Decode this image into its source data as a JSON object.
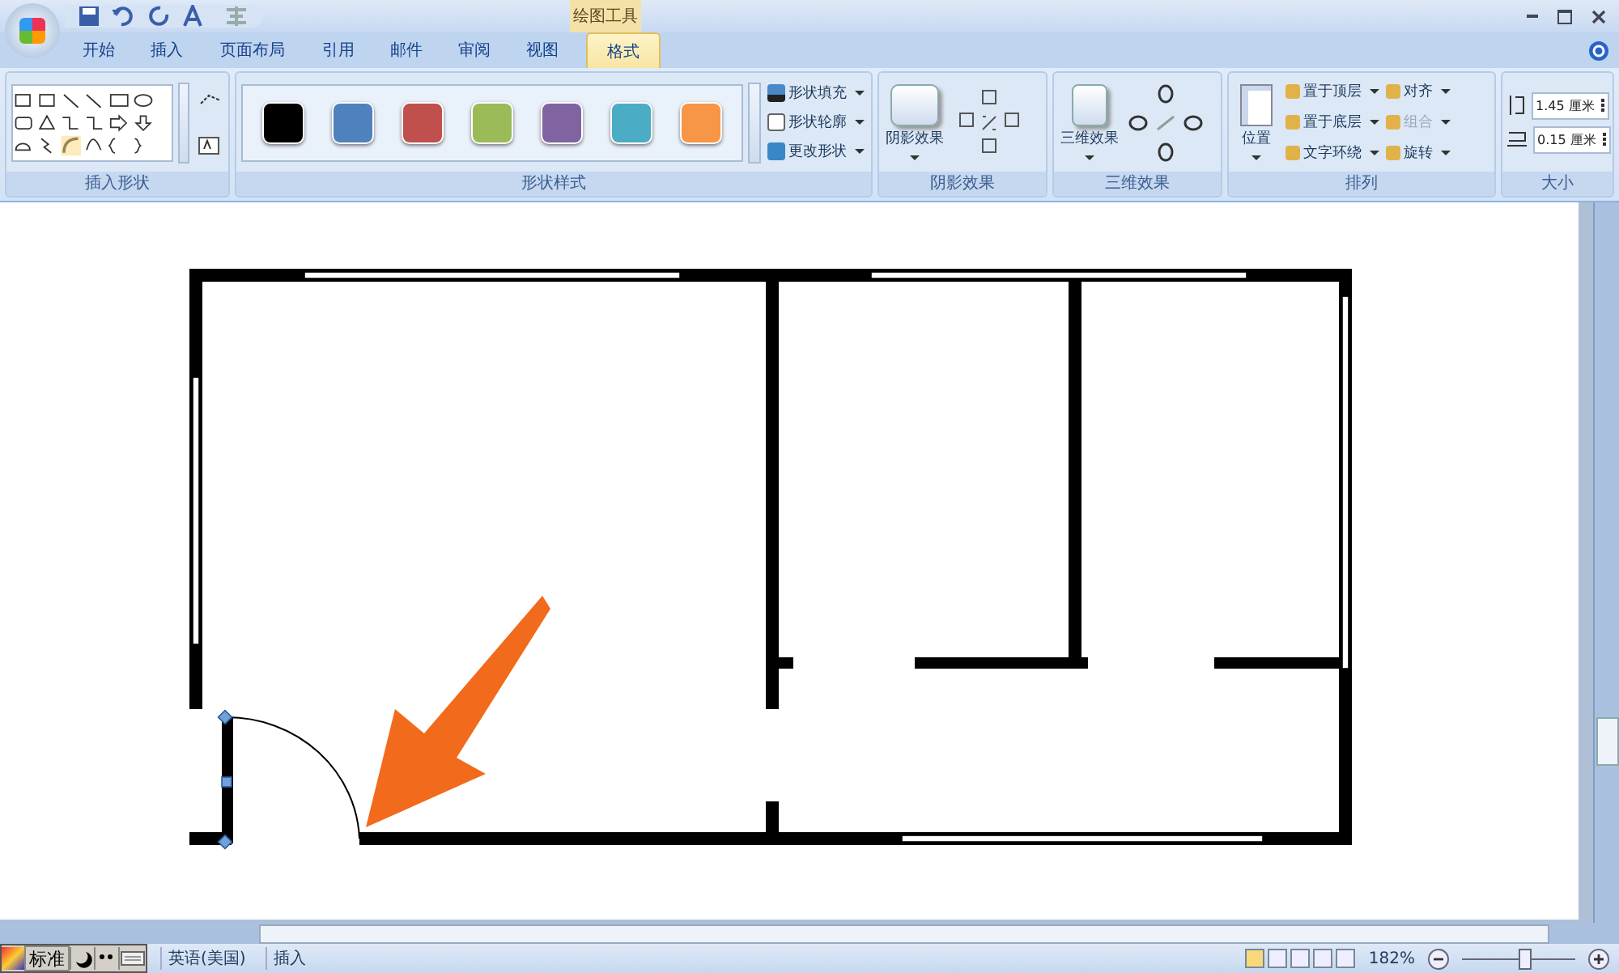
{
  "contextual_tab_group": {
    "label": "绘图工具"
  },
  "tabs": [
    {
      "label": "开始",
      "selected": false
    },
    {
      "label": "插入",
      "selected": false
    },
    {
      "label": "页面布局",
      "selected": false
    },
    {
      "label": "引用",
      "selected": false
    },
    {
      "label": "邮件",
      "selected": false
    },
    {
      "label": "审阅",
      "selected": false
    },
    {
      "label": "视图",
      "selected": false
    },
    {
      "label": "格式",
      "selected": true
    }
  ],
  "ribbon": {
    "insert_shapes": {
      "label": "插入形状"
    },
    "shape_styles": {
      "label": "形状样式",
      "swatches": [
        {
          "color": "#000000"
        },
        {
          "color": "#4f81bd"
        },
        {
          "color": "#c0504d"
        },
        {
          "color": "#9bbb59"
        },
        {
          "color": "#8064a2"
        },
        {
          "color": "#4bacc6"
        },
        {
          "color": "#f79646"
        }
      ],
      "commands": [
        "形状填充",
        "形状轮廓",
        "更改形状"
      ]
    },
    "shadow_effects": {
      "button": "阴影效果",
      "label": "阴影效果"
    },
    "effects_3d": {
      "button": "三维效果",
      "label": "三维效果"
    },
    "arrange": {
      "position": "位置",
      "commands": [
        {
          "label": "置于顶层",
          "disabled": false
        },
        {
          "label": "对齐",
          "disabled": false
        },
        {
          "label": "置于底层",
          "disabled": false
        },
        {
          "label": "组合",
          "disabled": true
        },
        {
          "label": "文字环绕",
          "disabled": false
        },
        {
          "label": "旋转",
          "disabled": false
        }
      ],
      "label": "排列"
    },
    "size": {
      "height": "1.45 厘米",
      "width": "0.15 厘米",
      "label": "大小"
    }
  },
  "status_bar": {
    "ime": "标准",
    "language": "英语(美国)",
    "mode": "插入",
    "zoom": "182%",
    "zoom_slider": {
      "level": 0.55
    }
  }
}
